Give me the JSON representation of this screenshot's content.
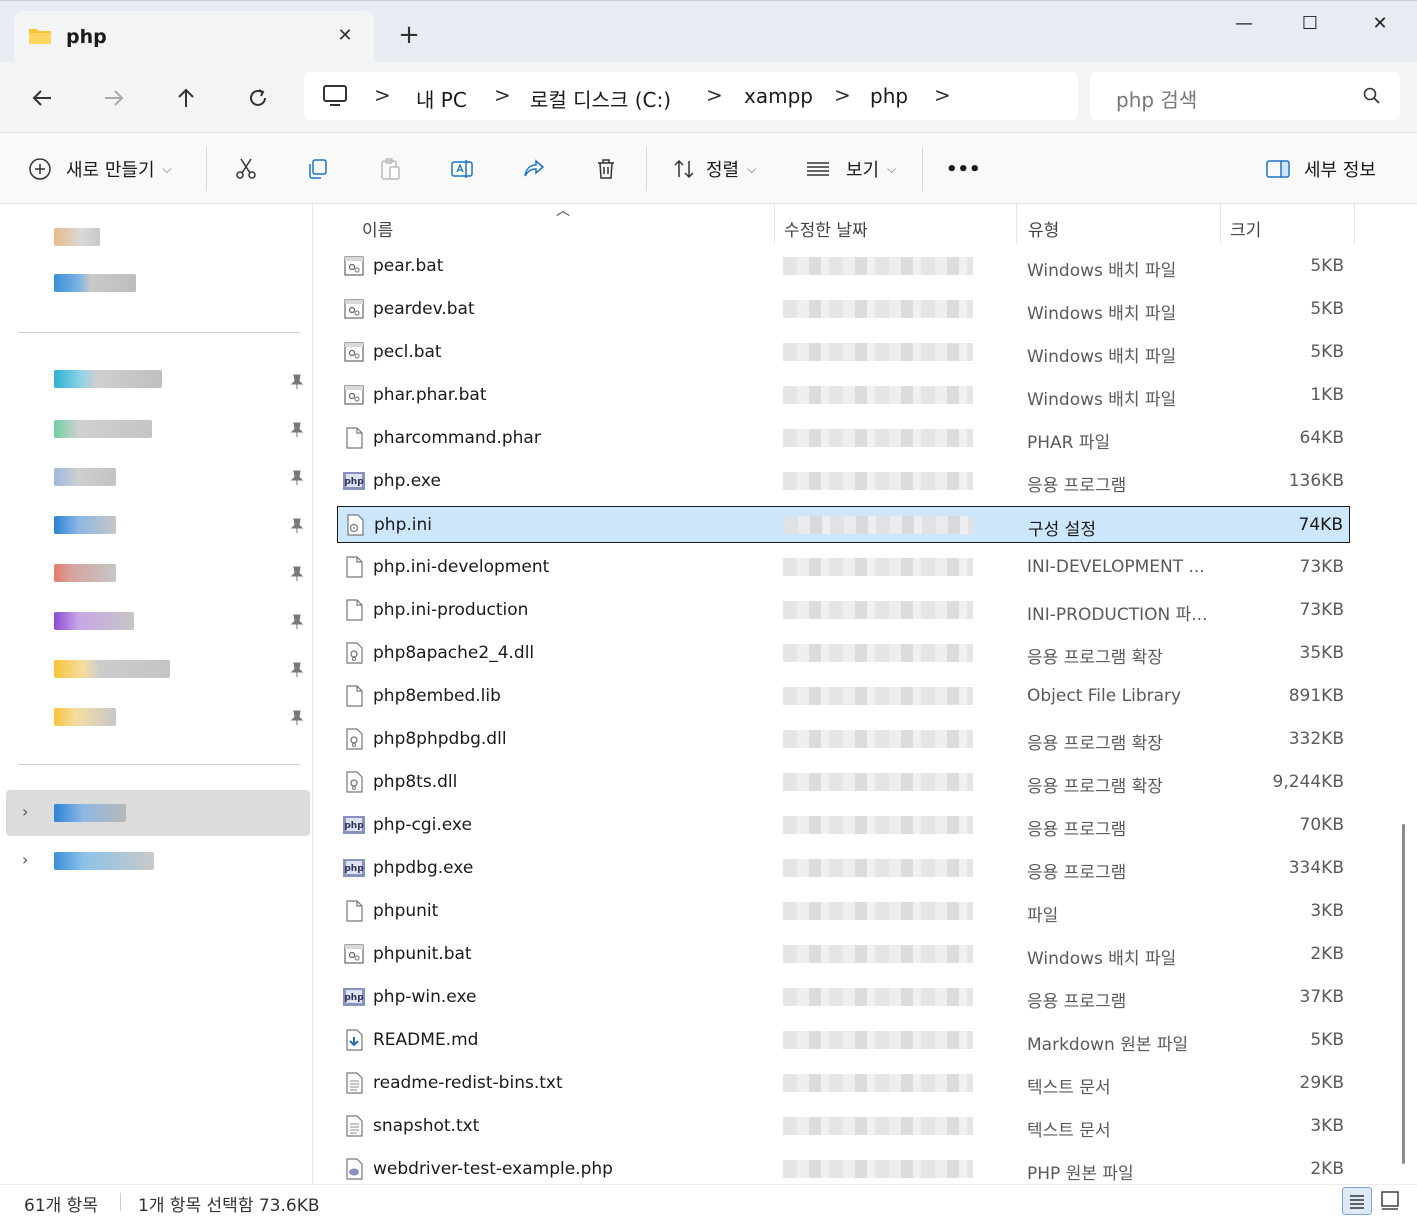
{
  "window": {
    "tab_title": "php",
    "new_tab": "+",
    "close_tab": "✕",
    "minimize": "—",
    "maximize": "☐",
    "close": "✕"
  },
  "address": {
    "breadcrumbs": [
      "내 PC",
      "로컬 디스크 (C:)",
      "xampp",
      "php"
    ],
    "separator": ">",
    "search_placeholder": "php 검색"
  },
  "toolbar": {
    "new_label": "새로 만들기",
    "sort_label": "정렬",
    "view_label": "보기",
    "more_label": "•••",
    "details_label": "세부 정보"
  },
  "columns": {
    "name": "이름",
    "date": "수정한 날짜",
    "type": "유형",
    "size": "크기"
  },
  "files": [
    {
      "name": "pear.bat",
      "type": "Windows 배치 파일",
      "size": "5KB",
      "icon": "batch-file"
    },
    {
      "name": "peardev.bat",
      "type": "Windows 배치 파일",
      "size": "5KB",
      "icon": "batch-file"
    },
    {
      "name": "pecl.bat",
      "type": "Windows 배치 파일",
      "size": "5KB",
      "icon": "batch-file"
    },
    {
      "name": "phar.phar.bat",
      "type": "Windows 배치 파일",
      "size": "1KB",
      "icon": "batch-file"
    },
    {
      "name": "pharcommand.phar",
      "type": "PHAR 파일",
      "size": "64KB",
      "icon": "blank-file"
    },
    {
      "name": "php.exe",
      "type": "응용 프로그램",
      "size": "136KB",
      "icon": "php-exe"
    },
    {
      "name": "php.ini",
      "type": "구성 설정",
      "size": "74KB",
      "icon": "ini-file",
      "selected": true
    },
    {
      "name": "php.ini-development",
      "type": "INI-DEVELOPMENT ...",
      "size": "73KB",
      "icon": "blank-file"
    },
    {
      "name": "php.ini-production",
      "type": "INI-PRODUCTION 파...",
      "size": "73KB",
      "icon": "blank-file"
    },
    {
      "name": "php8apache2_4.dll",
      "type": "응용 프로그램 확장",
      "size": "35KB",
      "icon": "dll-file"
    },
    {
      "name": "php8embed.lib",
      "type": "Object File Library",
      "size": "891KB",
      "icon": "blank-file"
    },
    {
      "name": "php8phpdbg.dll",
      "type": "응용 프로그램 확장",
      "size": "332KB",
      "icon": "dll-file"
    },
    {
      "name": "php8ts.dll",
      "type": "응용 프로그램 확장",
      "size": "9,244KB",
      "icon": "dll-file"
    },
    {
      "name": "php-cgi.exe",
      "type": "응용 프로그램",
      "size": "70KB",
      "icon": "php-exe"
    },
    {
      "name": "phpdbg.exe",
      "type": "응용 프로그램",
      "size": "334KB",
      "icon": "php-exe"
    },
    {
      "name": "phpunit",
      "type": "파일",
      "size": "3KB",
      "icon": "blank-file"
    },
    {
      "name": "phpunit.bat",
      "type": "Windows 배치 파일",
      "size": "2KB",
      "icon": "batch-file"
    },
    {
      "name": "php-win.exe",
      "type": "응용 프로그램",
      "size": "37KB",
      "icon": "php-exe"
    },
    {
      "name": "README.md",
      "type": "Markdown 원본 파일",
      "size": "5KB",
      "icon": "markdown-file"
    },
    {
      "name": "readme-redist-bins.txt",
      "type": "텍스트 문서",
      "size": "29KB",
      "icon": "text-file"
    },
    {
      "name": "snapshot.txt",
      "type": "텍스트 문서",
      "size": "3KB",
      "icon": "text-file"
    },
    {
      "name": "webdriver-test-example.php",
      "type": "PHP 원본 파일",
      "size": "2KB",
      "icon": "php-source-file"
    }
  ],
  "status": {
    "item_count": "61개 항목",
    "selection": "1개 항목 선택함 73.6KB"
  },
  "colors": {
    "selection": "#cce6fb",
    "tabbar": "#e7ebf2",
    "accent": "#0067c0"
  }
}
